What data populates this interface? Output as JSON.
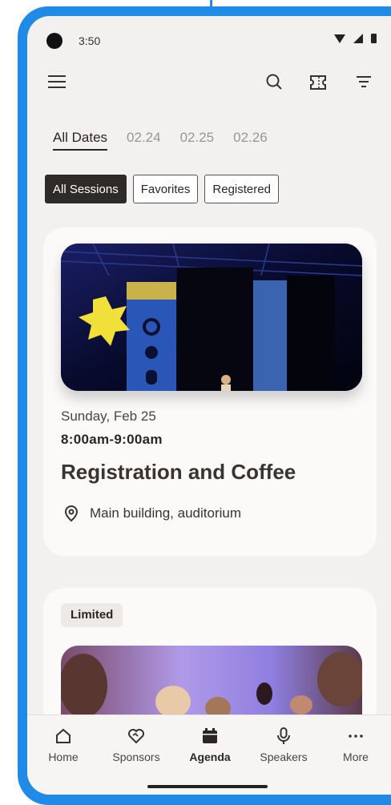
{
  "status_bar": {
    "time": "3:50"
  },
  "date_tabs": [
    {
      "label": "All Dates",
      "active": true
    },
    {
      "label": "02.24",
      "active": false
    },
    {
      "label": "02.25",
      "active": false
    },
    {
      "label": "02.26",
      "active": false
    }
  ],
  "filters": [
    {
      "label": "All Sessions",
      "active": true
    },
    {
      "label": "Favorites",
      "active": false
    },
    {
      "label": "Registered",
      "active": false
    }
  ],
  "sessions": [
    {
      "date": "Sunday, Feb 25",
      "time": "8:00am-9:00am",
      "title": "Registration and Coffee",
      "location": "Main building, auditorium"
    },
    {
      "badge": "Limited"
    }
  ],
  "bottom_nav": [
    {
      "label": "Home",
      "icon": "home-icon"
    },
    {
      "label": "Sponsors",
      "icon": "handshake-icon"
    },
    {
      "label": "Agenda",
      "icon": "calendar-icon",
      "active": true
    },
    {
      "label": "Speakers",
      "icon": "microphone-icon"
    },
    {
      "label": "More",
      "icon": "more-dots-icon"
    }
  ],
  "colors": {
    "frame": "#1f8be6",
    "background": "#f3f1ef",
    "active_chip": "#2e2a27"
  }
}
